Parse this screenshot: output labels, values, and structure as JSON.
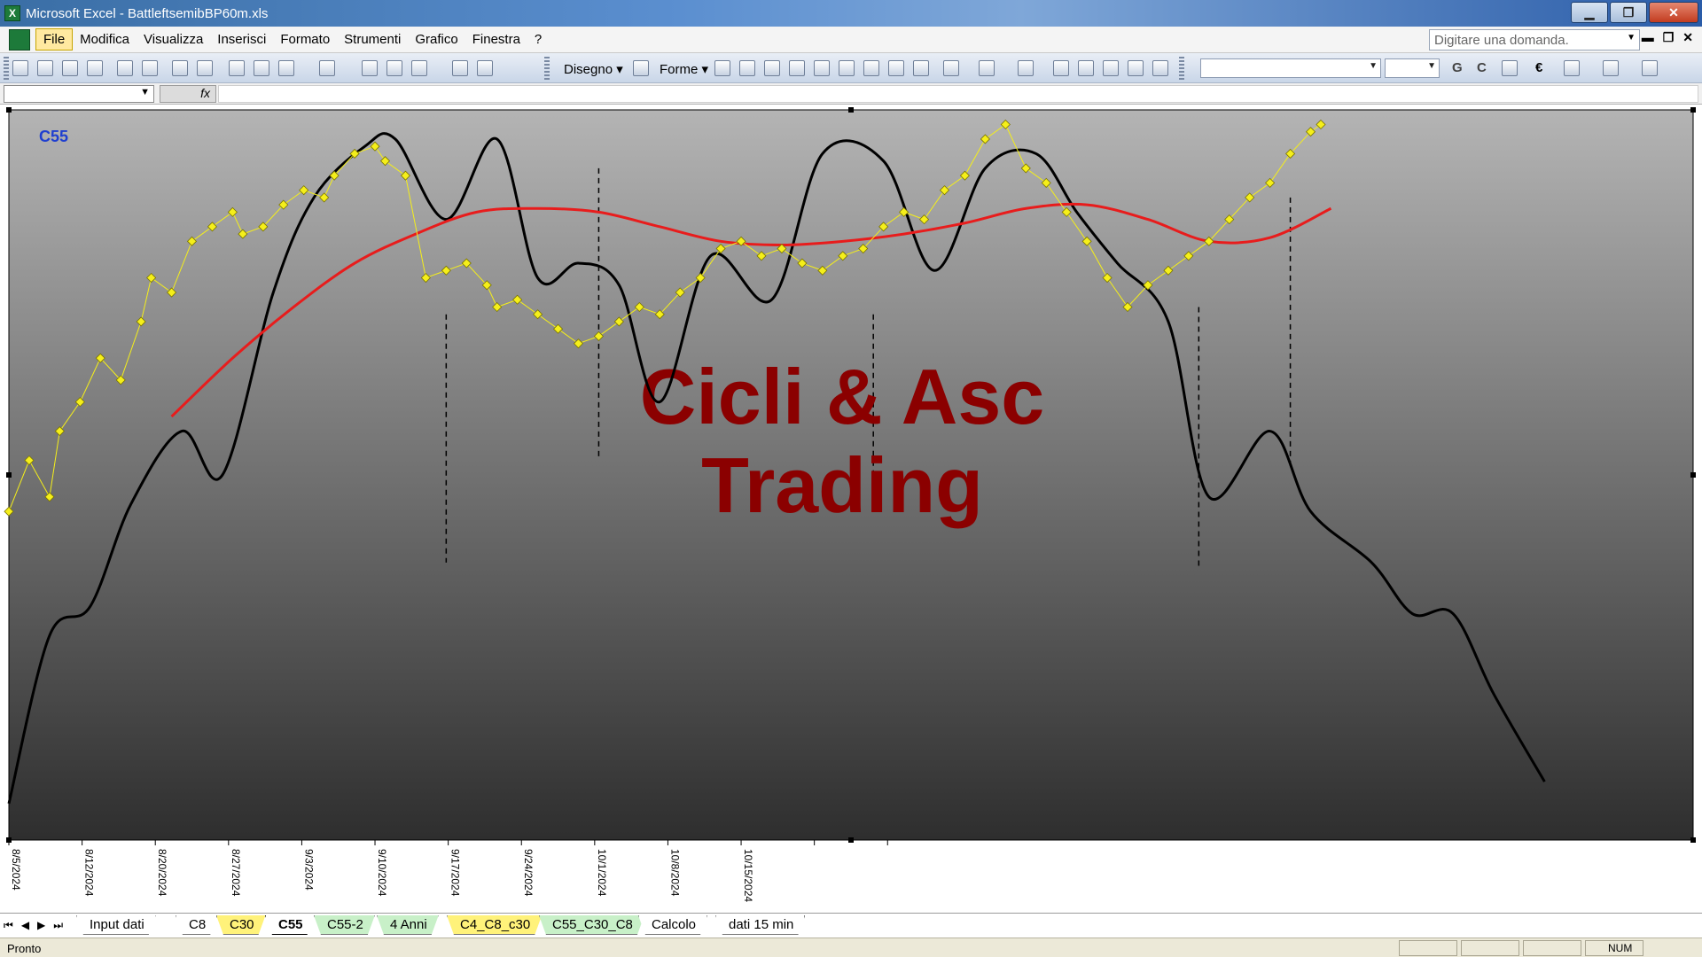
{
  "window": {
    "title": "Microsoft Excel - BattleftsemibBP60m.xls",
    "app_icon": "excel-icon",
    "minimize_label": "▁",
    "maximize_label": "❐",
    "close_label": "✕"
  },
  "menu": {
    "items": [
      "File",
      "Modifica",
      "Visualizza",
      "Inserisci",
      "Formato",
      "Strumenti",
      "Grafico",
      "Finestra",
      "?"
    ],
    "help_placeholder": "Digitare una domanda.",
    "doc_minimize": "▬",
    "doc_restore": "❐",
    "doc_close": "✕"
  },
  "toolbar": {
    "disegno_label": "Disegno ▾",
    "forme_label": "Forme ▾",
    "bold_label": "G",
    "italic_label": "C",
    "euro_label": "€"
  },
  "formula": {
    "fx_label": "fx"
  },
  "chart_data": {
    "type": "line",
    "title": "C55",
    "watermark": [
      "Cicli & Asc",
      "Trading"
    ],
    "colors": {
      "price": "#f5ef1a",
      "price_marker_border": "#7a7400",
      "moving_average": "#e81c1c",
      "cycle": "#000000",
      "watermark": "#8b0000",
      "title": "#1f3fd0",
      "background_top": "#b4b4b4",
      "background_bottom": "#2e2e2e"
    },
    "x_tick_labels": [
      "8/5/2024",
      "8/12/2024",
      "8/20/2024",
      "8/27/2024",
      "9/3/2024",
      "9/10/2024",
      "9/17/2024",
      "9/24/2024",
      "10/1/2024",
      "10/8/2024",
      "10/15/2024"
    ],
    "x_range_days": [
      0,
      129
    ],
    "y_range": [
      0,
      100
    ],
    "series": [
      {
        "marker": "diamond",
        "x": [
          0,
          2,
          4,
          5,
          7,
          9,
          11,
          13,
          14,
          16,
          18,
          20,
          22,
          23,
          25,
          27,
          29,
          31,
          32,
          34,
          36,
          37,
          39,
          41,
          43,
          45,
          47,
          48,
          50,
          52,
          54,
          56,
          58,
          60,
          62,
          64,
          66,
          68,
          70,
          72,
          74,
          76,
          78,
          80,
          82,
          84,
          86,
          88,
          90,
          92,
          94,
          96,
          98,
          100,
          102,
          104,
          106,
          108,
          110,
          112,
          114,
          116,
          118,
          120,
          122,
          124,
          126,
          128,
          129
        ],
        "values": [
          45,
          52,
          47,
          56,
          60,
          66,
          63,
          71,
          77,
          75,
          82,
          84,
          86,
          83,
          84,
          87,
          89,
          88,
          91,
          94,
          95,
          93,
          91,
          77,
          78,
          79,
          76,
          73,
          74,
          72,
          70,
          68,
          69,
          71,
          73,
          72,
          75,
          77,
          81,
          82,
          80,
          81,
          79,
          78,
          80,
          81,
          84,
          86,
          85,
          89,
          91,
          96,
          98,
          92,
          90,
          86,
          82,
          77,
          73,
          76,
          78,
          80,
          82,
          85,
          88,
          90,
          94,
          97,
          98
        ]
      },
      {
        "x": [
          16,
          22,
          28,
          34,
          40,
          46,
          52,
          58,
          64,
          70,
          76,
          82,
          88,
          94,
          100,
          106,
          112,
          118,
          124,
          130
        ],
        "values": [
          58,
          66,
          73,
          79,
          83,
          86,
          86.5,
          86,
          84,
          82,
          81.5,
          82,
          83,
          84.5,
          86.5,
          87,
          85,
          82,
          82.5,
          86.5
        ]
      },
      {
        "x": [
          0,
          4,
          8,
          12,
          17,
          21,
          26,
          30,
          35,
          38,
          43,
          48,
          52,
          56,
          60,
          64,
          69,
          75,
          80,
          86,
          91,
          96,
          101,
          105,
          109,
          114,
          118,
          124,
          128,
          134,
          138,
          142,
          146,
          151
        ],
        "values": [
          5,
          28,
          32,
          46,
          56,
          50,
          75,
          88,
          95,
          96,
          85,
          96,
          77,
          79,
          76,
          60,
          80,
          74,
          94,
          93,
          78,
          92,
          94,
          86,
          79,
          71,
          47,
          56,
          45,
          38,
          31,
          31,
          20,
          8
        ]
      }
    ],
    "cycle_x_extent_days": 151,
    "vertical_markers_days": [
      43,
      58,
      85,
      117,
      126
    ],
    "grid": false,
    "legend": "none"
  },
  "sheet_tabs": {
    "nav": [
      "⏮",
      "◀",
      "▶",
      "⏭"
    ],
    "tabs": [
      {
        "label": "Input dati",
        "color": "#ffffff",
        "active": false
      },
      {
        "label": "C8",
        "color": "#ffffff",
        "active": false
      },
      {
        "label": "C30",
        "color": "#fff27a",
        "active": false
      },
      {
        "label": "C55",
        "color": "#ffffff",
        "active": true
      },
      {
        "label": "C55-2",
        "color": "#c8f0c8",
        "active": false
      },
      {
        "label": "4 Anni",
        "color": "#c8f0c8",
        "active": false
      },
      {
        "label": "C4_C8_c30",
        "color": "#fff27a",
        "active": false
      },
      {
        "label": "C55_C30_C8",
        "color": "#c8f0c8",
        "active": false
      },
      {
        "label": "Calcolo",
        "color": "#ffffff",
        "active": false
      },
      {
        "label": "dati 15 min",
        "color": "#ffffff",
        "active": false
      }
    ]
  },
  "status": {
    "text": "Pronto",
    "num": "NUM"
  }
}
